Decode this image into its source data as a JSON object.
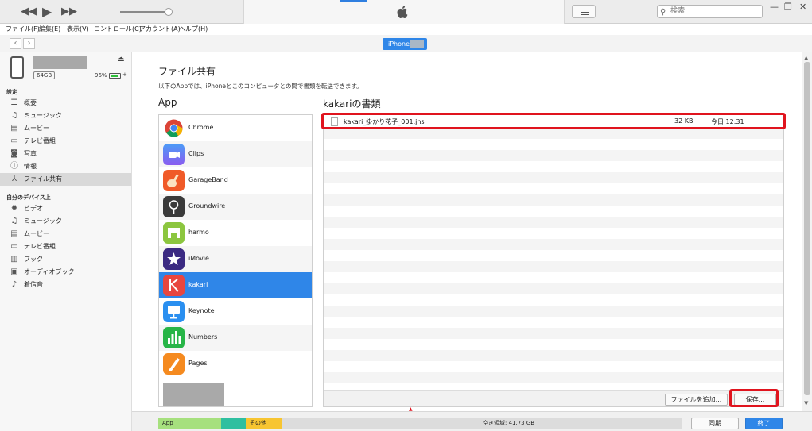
{
  "search": {
    "placeholder": "検索"
  },
  "menu": [
    "ファイル(F)",
    "編集(E)",
    "表示(V)",
    "コントロール(C)",
    "アカウント(A)",
    "ヘルプ(H)"
  ],
  "nav": {
    "device_label": "iPhone"
  },
  "device": {
    "capacity": "64GB",
    "battery": "96%"
  },
  "sidebar": {
    "settings_header": "設定",
    "settings": [
      {
        "label": "概要",
        "icon": "summary-list-icon"
      },
      {
        "label": "ミュージック",
        "icon": "music-note-icon"
      },
      {
        "label": "ムービー",
        "icon": "film-icon"
      },
      {
        "label": "テレビ番組",
        "icon": "tv-icon"
      },
      {
        "label": "写真",
        "icon": "camera-icon"
      },
      {
        "label": "情報",
        "icon": "info-icon"
      },
      {
        "label": "ファイル共有",
        "icon": "app-store-icon",
        "selected": true
      }
    ],
    "ondevice_header": "自分のデバイス上",
    "ondevice": [
      {
        "label": "ビデオ",
        "icon": "gear-video-icon"
      },
      {
        "label": "ミュージック",
        "icon": "music-note-icon"
      },
      {
        "label": "ムービー",
        "icon": "film-icon"
      },
      {
        "label": "テレビ番組",
        "icon": "tv-icon"
      },
      {
        "label": "ブック",
        "icon": "book-icon"
      },
      {
        "label": "オーディオブック",
        "icon": "audiobook-icon"
      },
      {
        "label": "着信音",
        "icon": "bell-icon"
      }
    ]
  },
  "main": {
    "title": "ファイル共有",
    "description": "以下のAppでは、iPhoneとこのコンピュータとの間で書類を転送できます。",
    "apps_header": "App",
    "docs_header": "kakariの書類",
    "apps": [
      {
        "name": "Chrome",
        "icon": "chrome-icon"
      },
      {
        "name": "Clips",
        "icon": "clips-icon"
      },
      {
        "name": "GarageBand",
        "icon": "garageband-icon"
      },
      {
        "name": "Groundwire",
        "icon": "groundwire-icon"
      },
      {
        "name": "harmo",
        "icon": "harmo-icon"
      },
      {
        "name": "iMovie",
        "icon": "imovie-icon"
      },
      {
        "name": "kakari",
        "icon": "kakari-icon",
        "selected": true
      },
      {
        "name": "Keynote",
        "icon": "keynote-icon"
      },
      {
        "name": "Numbers",
        "icon": "numbers-icon"
      },
      {
        "name": "Pages",
        "icon": "pages-icon"
      }
    ],
    "document": {
      "name": "kakari_掛かり花子_001.jhs",
      "size": "32 KB",
      "date": "今日 12:31"
    },
    "add_file_button": "ファイルを追加...",
    "save_button": "保存..."
  },
  "storage": {
    "segments": [
      {
        "label": "App",
        "color": "#a6e07e"
      },
      {
        "label": "",
        "color": "#2fbfa0"
      },
      {
        "label": "その他",
        "color": "#f7c531"
      }
    ],
    "free_label": "空き領域: 41.73 GB"
  },
  "bottom": {
    "sync_button": "同期",
    "done_button": "終了"
  },
  "colors": {
    "accent": "#2f86e8",
    "highlight": "#e0141e"
  }
}
